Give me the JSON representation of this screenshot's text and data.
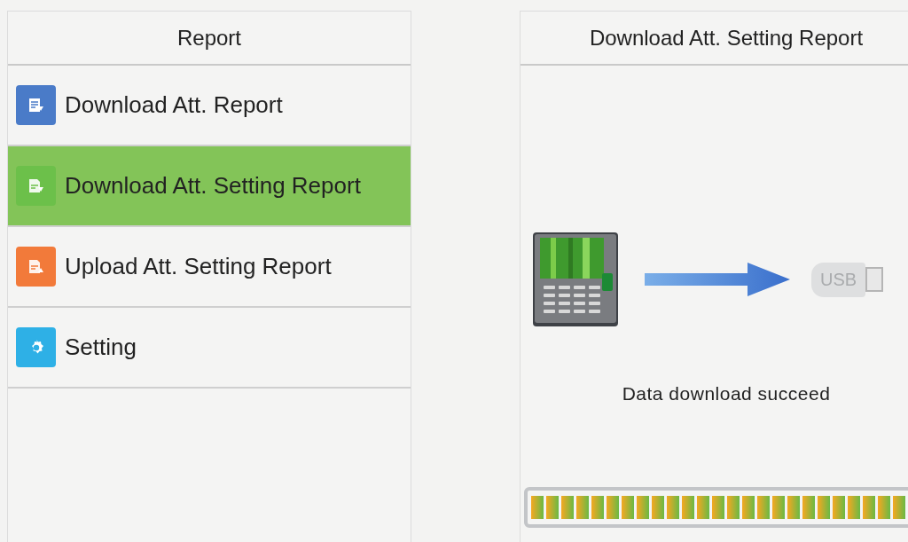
{
  "menu": {
    "title": "Report",
    "items": [
      {
        "label": "Download Att. Report",
        "kind": "download-report",
        "color": "#4a7bc8",
        "selected": false
      },
      {
        "label": "Download Att. Setting Report",
        "kind": "download-setting",
        "color": "#6cc04a",
        "selected": true
      },
      {
        "label": "Upload Att. Setting Report",
        "kind": "upload-setting",
        "color": "#f27a3a",
        "selected": false
      },
      {
        "label": "Setting",
        "kind": "setting",
        "color": "#2eb0e6",
        "selected": false
      }
    ]
  },
  "dialog": {
    "title": "Download Att. Setting Report",
    "usb_label": "USB",
    "message": "Data download succeed",
    "progress": {
      "level": 1
    }
  }
}
